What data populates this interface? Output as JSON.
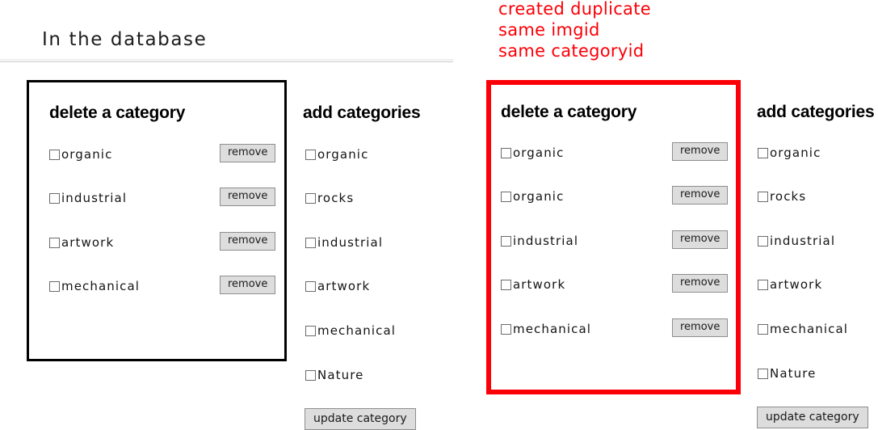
{
  "page": {
    "title": "In the database"
  },
  "annotation": {
    "lines": [
      "created duplicate",
      "same imgid",
      "same categoryid"
    ]
  },
  "colors": {
    "annotation_red": "#fb0007",
    "highlight_border_red": "#fb0007",
    "panel_border_black": "#000000",
    "button_face": "#dddddd",
    "button_border": "#8e8e8e"
  },
  "left_section": {
    "delete_panel": {
      "heading": "delete a category",
      "border_color": "#000000",
      "rows": [
        {
          "label": "organic",
          "checked": false,
          "button": "remove"
        },
        {
          "label": "industrial",
          "checked": false,
          "button": "remove"
        },
        {
          "label": "artwork",
          "checked": false,
          "button": "remove"
        },
        {
          "label": "mechanical",
          "checked": false,
          "button": "remove"
        }
      ]
    },
    "add_panel": {
      "heading": "add categories",
      "rows": [
        {
          "label": "organic",
          "checked": false
        },
        {
          "label": "rocks",
          "checked": false
        },
        {
          "label": "industrial",
          "checked": false
        },
        {
          "label": "artwork",
          "checked": false
        },
        {
          "label": "mechanical",
          "checked": false
        },
        {
          "label": "Nature",
          "checked": false
        }
      ],
      "submit_button": "update category"
    }
  },
  "right_section": {
    "delete_panel": {
      "heading": "delete a category",
      "border_color": "#fb0007",
      "rows": [
        {
          "label": "organic",
          "checked": false,
          "button": "remove"
        },
        {
          "label": "organic",
          "checked": false,
          "button": "remove"
        },
        {
          "label": "industrial",
          "checked": false,
          "button": "remove"
        },
        {
          "label": "artwork",
          "checked": false,
          "button": "remove"
        },
        {
          "label": "mechanical",
          "checked": false,
          "button": "remove"
        }
      ]
    },
    "add_panel": {
      "heading": "add categories",
      "rows": [
        {
          "label": "organic",
          "checked": false
        },
        {
          "label": "rocks",
          "checked": false
        },
        {
          "label": "industrial",
          "checked": false
        },
        {
          "label": "artwork",
          "checked": false
        },
        {
          "label": "mechanical",
          "checked": false
        },
        {
          "label": "Nature",
          "checked": false
        }
      ],
      "submit_button": "update category"
    }
  }
}
